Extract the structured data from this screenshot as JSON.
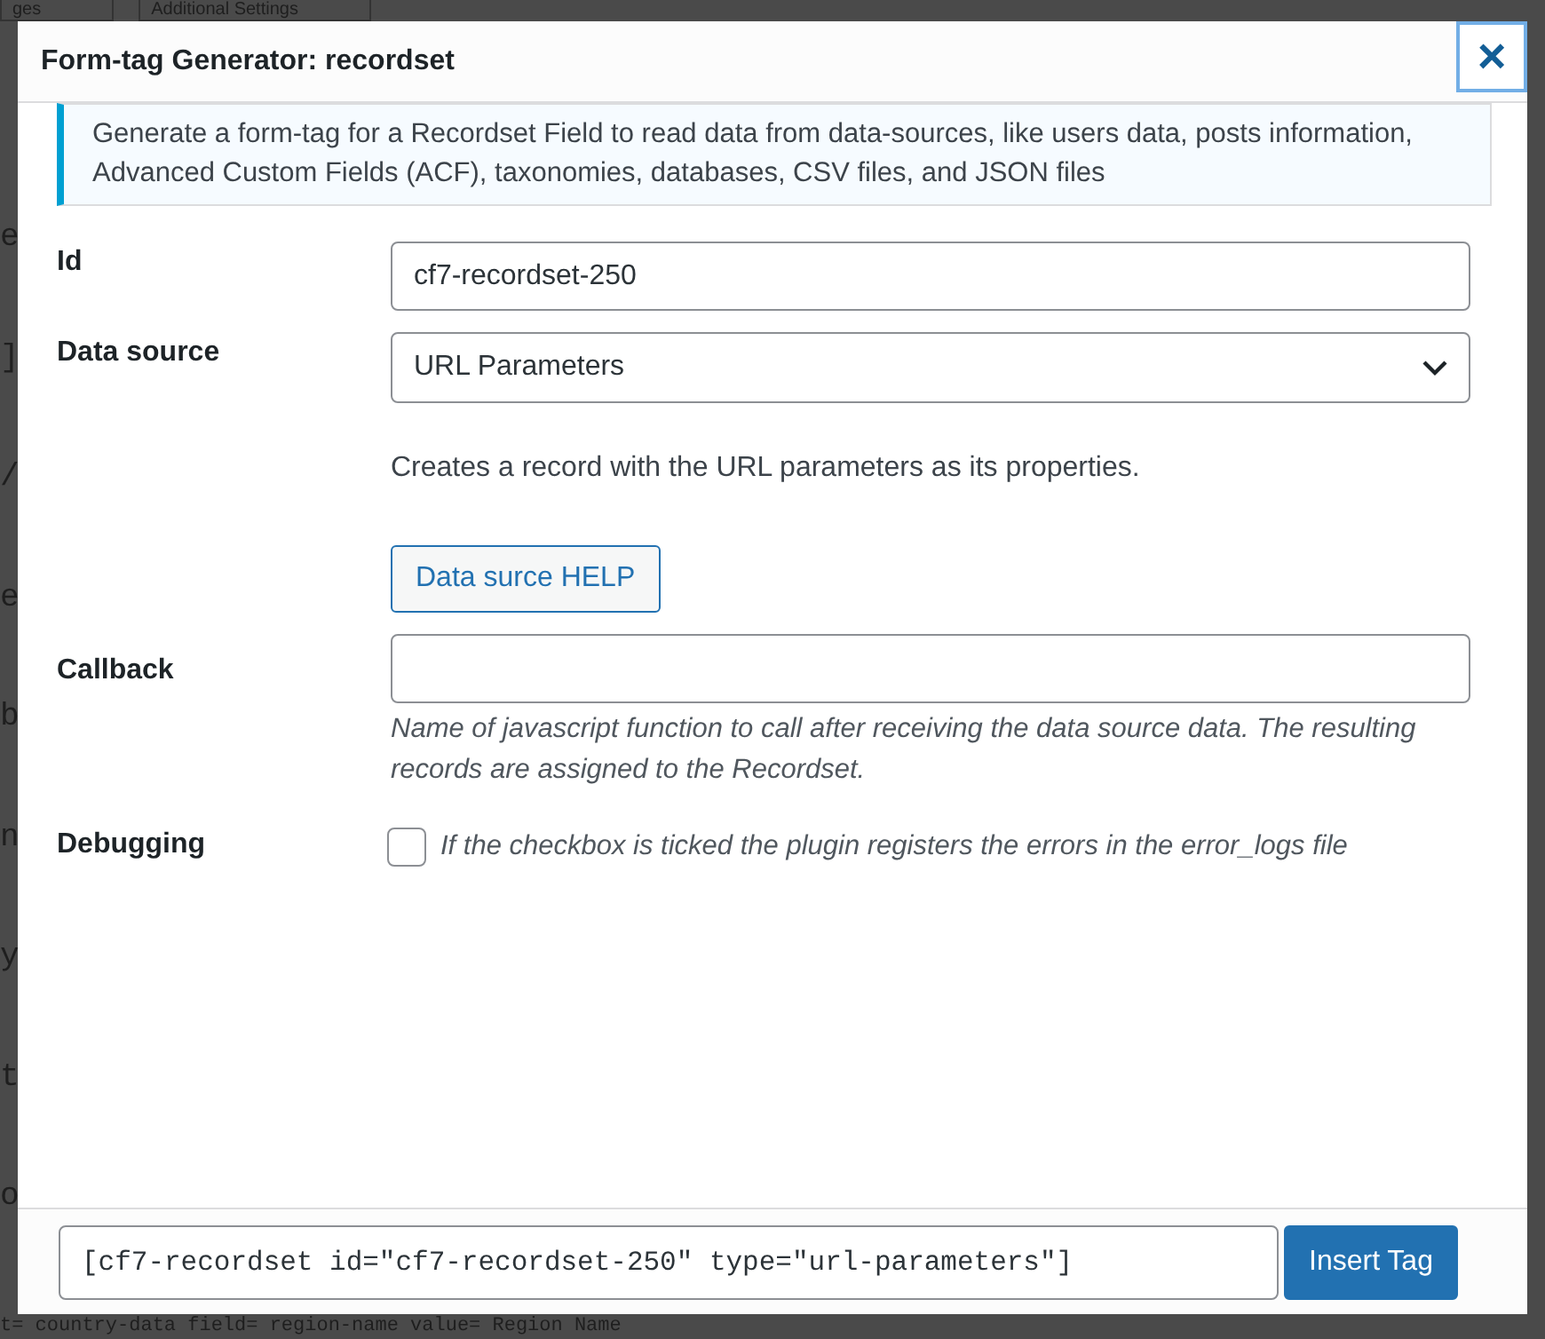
{
  "background": {
    "tabs": [
      "ges",
      "Additional Settings"
    ],
    "margin_letters": [
      "e",
      "]",
      "/",
      "e",
      "b",
      "n",
      "y",
      "t",
      "o"
    ],
    "code_line": "t= country-data field= region-name value= Region Name"
  },
  "dialog": {
    "title": "Form-tag Generator: recordset",
    "close": "×",
    "notice": "Generate a form-tag for a Recordset Field to read data from data-sources, like users data, posts information, Advanced Custom Fields (ACF), taxonomies, databases, CSV files, and JSON files",
    "fields": [
      {
        "kind": "text",
        "label": "Id",
        "value": "cf7-recordset-250"
      },
      {
        "kind": "select",
        "label": "Data source",
        "value": "URL Parameters",
        "description": "Creates a record with the URL parameters as its properties.",
        "button": "Data surce HELP"
      },
      {
        "kind": "text",
        "label": "Callback",
        "hint": "Name of javascript function to call after receiving the data source data. The resulting records are assigned to the Recordset."
      },
      {
        "kind": "checkbox",
        "label": "Debugging",
        "checked": false,
        "hint": "If the checkbox is ticked the plugin registers the errors in the error_logs file"
      }
    ],
    "tag": "[cf7-recordset id=\"cf7-recordset-250\" type=\"url-parameters\"]",
    "insert_button": "Insert Tag"
  }
}
